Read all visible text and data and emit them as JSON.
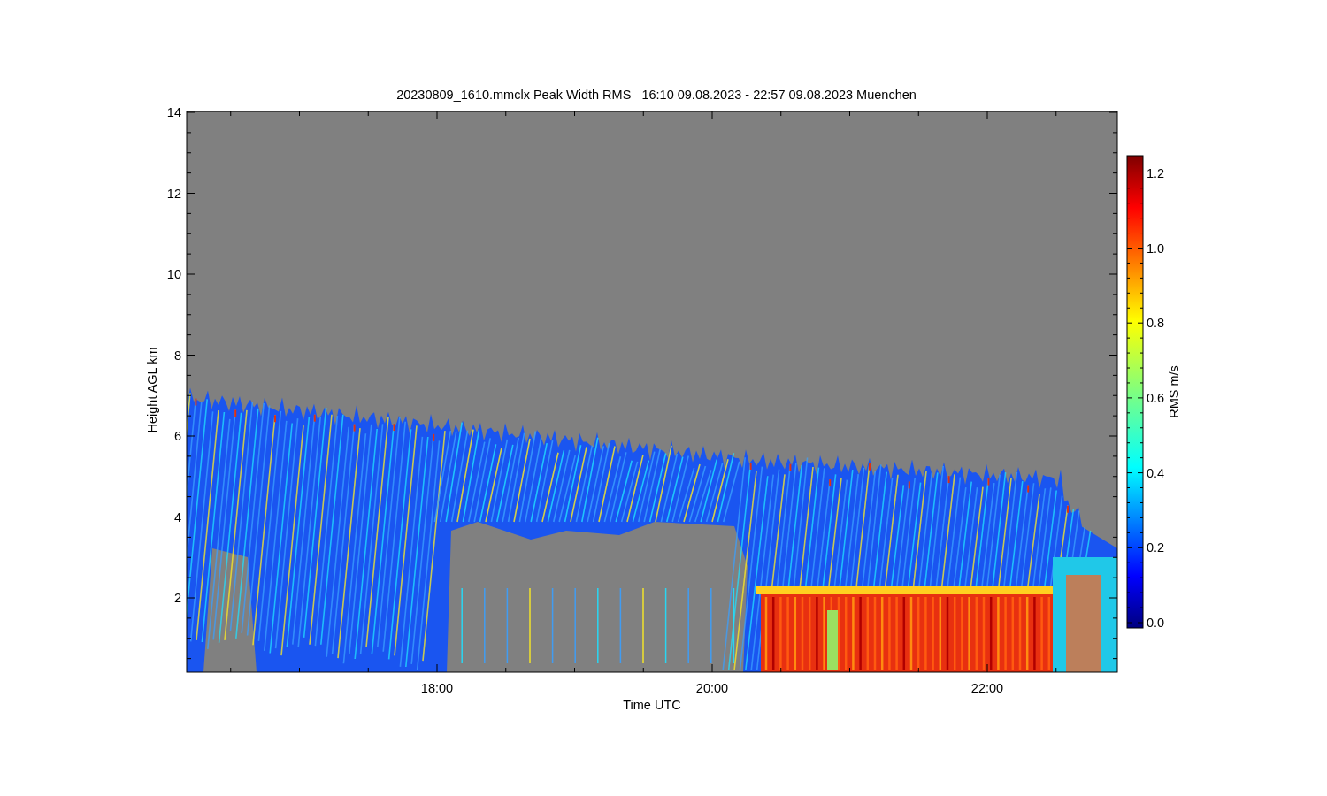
{
  "title": "20230809_1610.mmclx Peak Width RMS   16:10 09.08.2023 - 22:57 09.08.2023 Muenchen",
  "plot": {
    "xlabel": "Time UTC",
    "ylabel": "Height AGL km",
    "xticks": [
      "18:00",
      "20:00",
      "22:00"
    ],
    "yticks": [
      "14",
      "12",
      "10",
      "8",
      "6",
      "4",
      "2"
    ]
  },
  "colorbar": {
    "label": "RMS m/s",
    "ticks": [
      "1.2",
      "1.0",
      "0.8",
      "0.6",
      "0.4",
      "0.2",
      "0.0"
    ]
  }
}
